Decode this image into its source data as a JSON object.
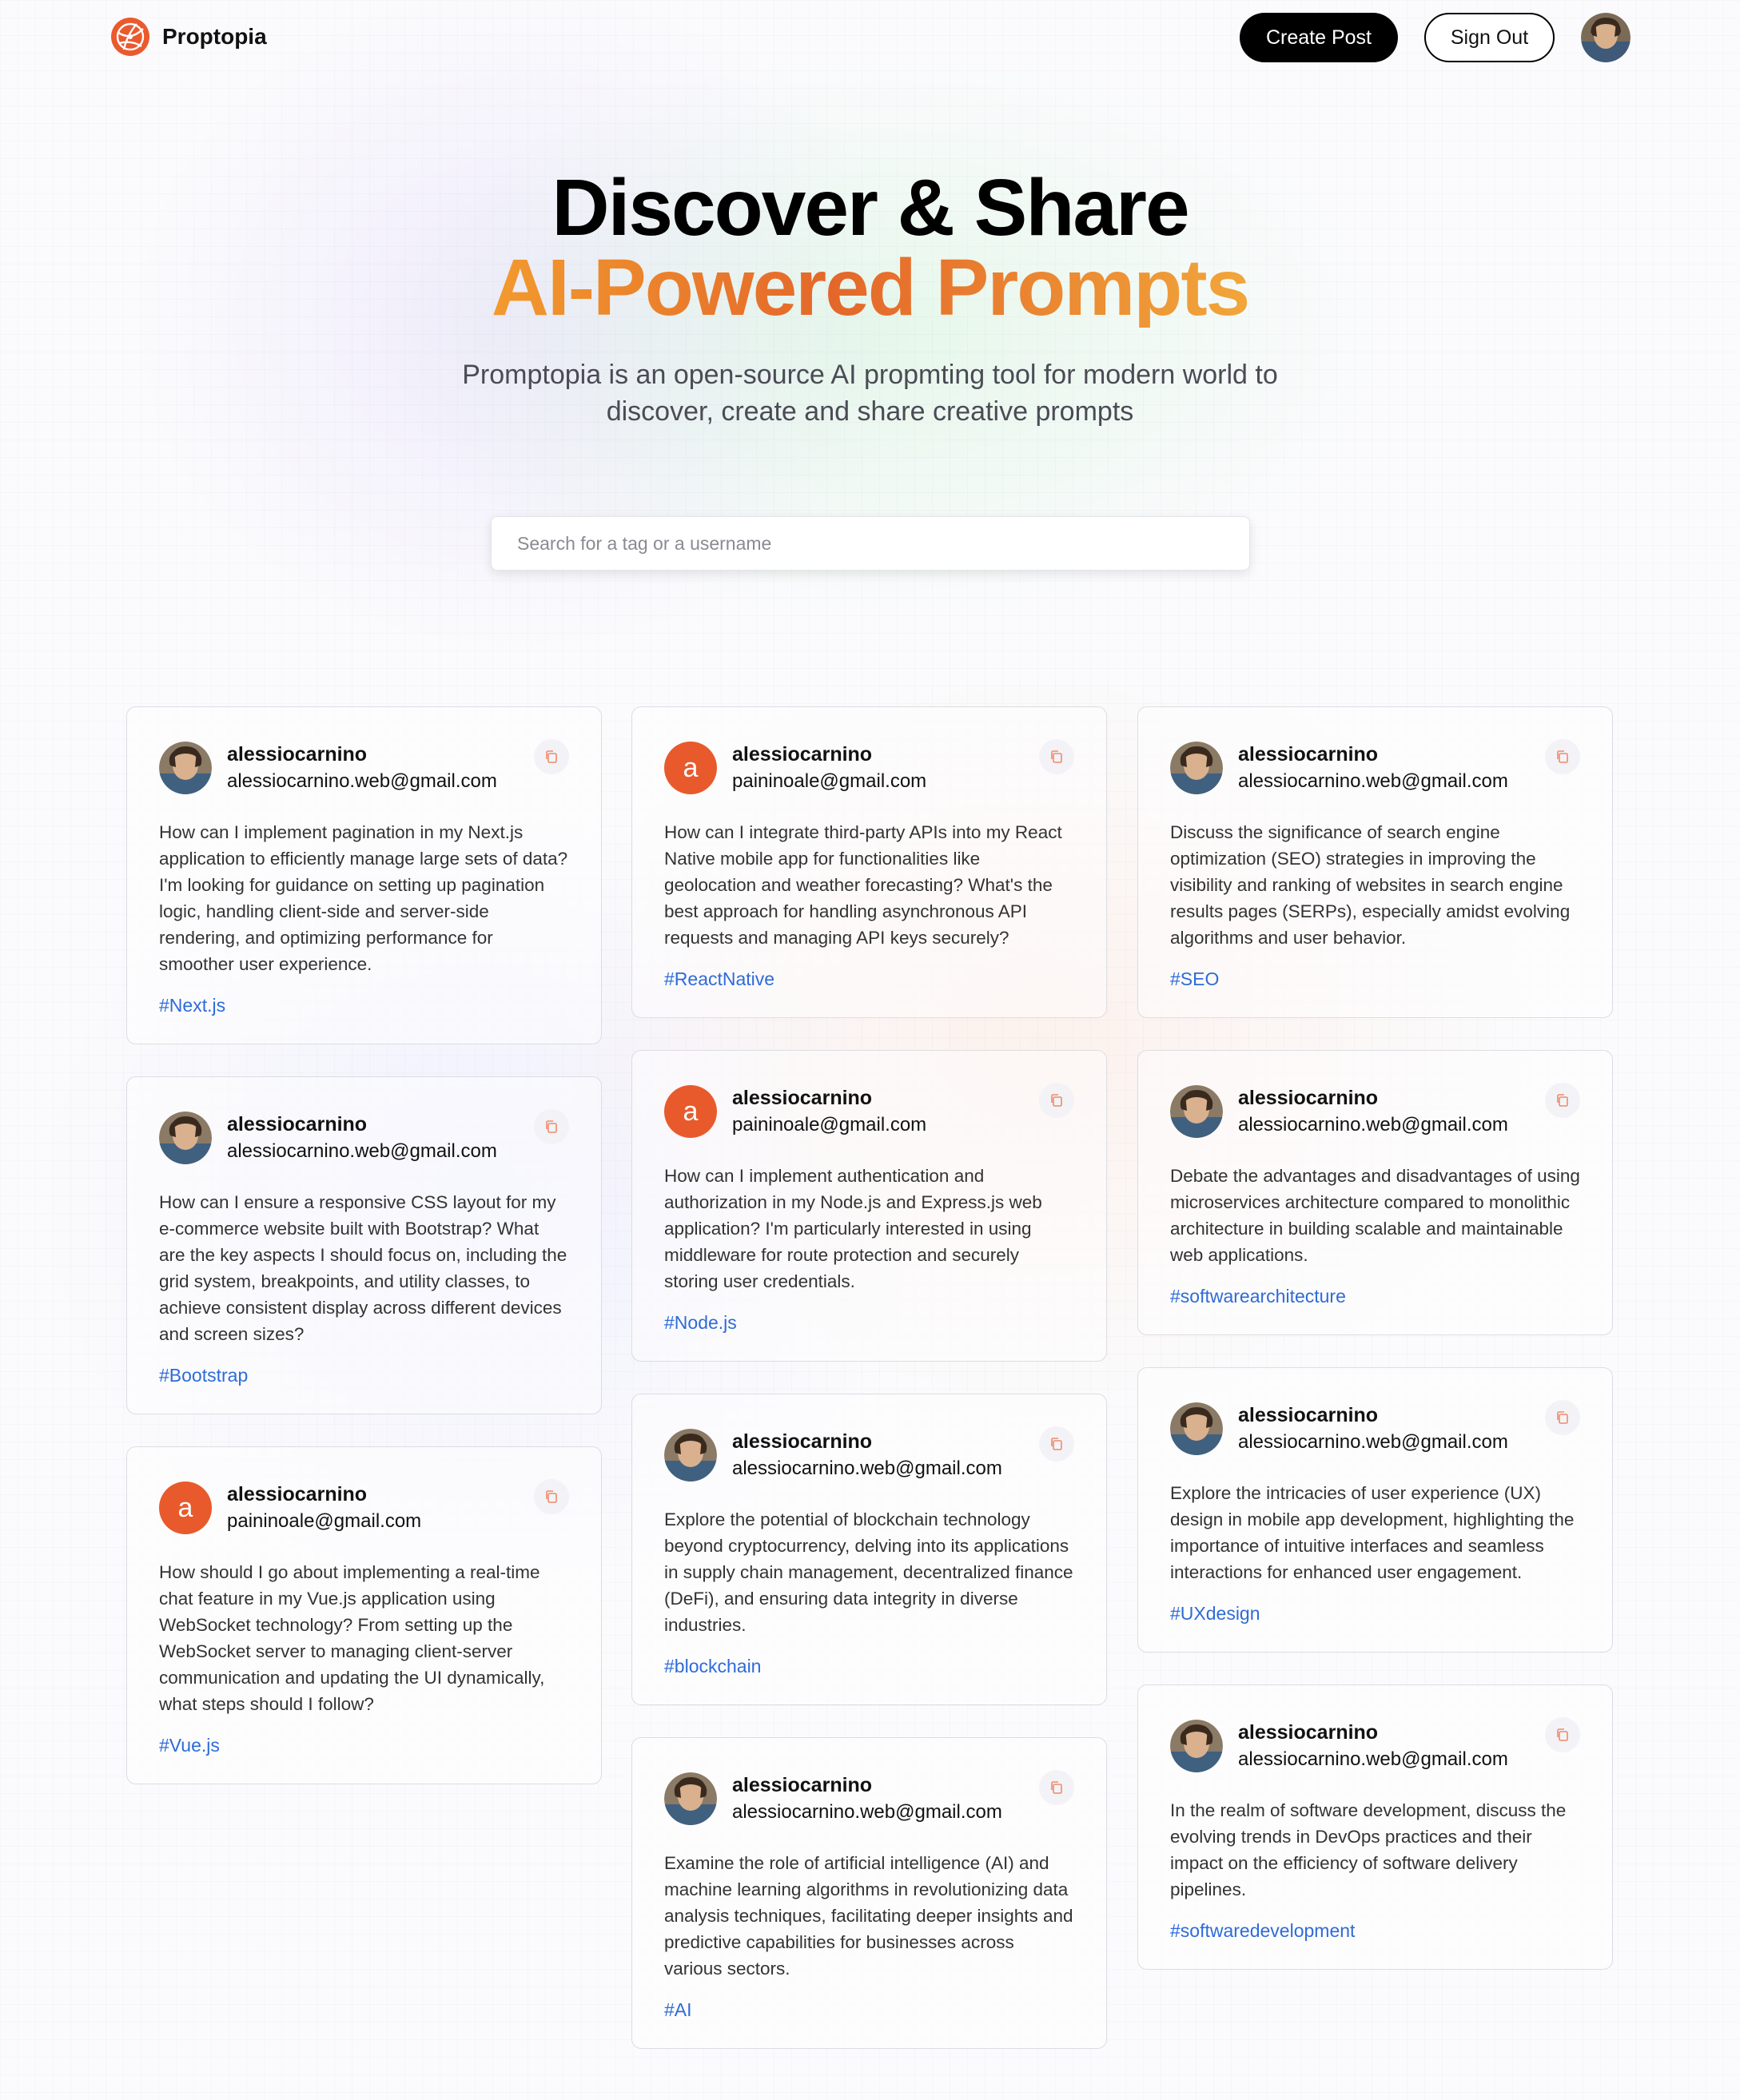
{
  "brand": {
    "name": "Proptopia"
  },
  "nav": {
    "create_label": "Create Post",
    "signout_label": "Sign Out"
  },
  "hero": {
    "title_line1": "Discover & Share",
    "title_line2": "AI-Powered Prompts",
    "description": "Promptopia is an open-source AI propmting tool for modern world to discover, create and share creative prompts"
  },
  "search": {
    "placeholder": "Search for a tag or a username",
    "value": ""
  },
  "colors": {
    "accent_orange": "#e85a2c",
    "tag_blue": "#2e6bd8"
  },
  "columns": [
    [
      {
        "avatar": "photo",
        "username": "alessiocarnino",
        "email": "alessiocarnino.web@gmail.com",
        "prompt": "How can I implement pagination in my Next.js application to efficiently manage large sets of data? I'm looking for guidance on setting up pagination logic, handling client-side and server-side rendering, and optimizing performance for smoother user experience.",
        "tag": "#Next.js"
      },
      {
        "avatar": "photo",
        "username": "alessiocarnino",
        "email": "alessiocarnino.web@gmail.com",
        "prompt": "How can I ensure a responsive CSS layout for my e-commerce website built with Bootstrap? What are the key aspects I should focus on, including the grid system, breakpoints, and utility classes, to achieve consistent display across different devices and screen sizes?",
        "tag": "#Bootstrap"
      },
      {
        "avatar": "letter",
        "letter": "a",
        "username": "alessiocarnino",
        "email": "paininoale@gmail.com",
        "prompt": "How should I go about implementing a real-time chat feature in my Vue.js application using WebSocket technology? From setting up the WebSocket server to managing client-server communication and updating the UI dynamically, what steps should I follow?",
        "tag": "#Vue.js"
      }
    ],
    [
      {
        "avatar": "letter",
        "letter": "a",
        "username": "alessiocarnino",
        "email": "paininoale@gmail.com",
        "prompt": "How can I integrate third-party APIs into my React Native mobile app for functionalities like geolocation and weather forecasting? What's the best approach for handling asynchronous API requests and managing API keys securely?",
        "tag": "#ReactNative"
      },
      {
        "avatar": "letter",
        "letter": "a",
        "username": "alessiocarnino",
        "email": "paininoale@gmail.com",
        "prompt": "How can I implement authentication and authorization in my Node.js and Express.js web application? I'm particularly interested in using middleware for route protection and securely storing user credentials.",
        "tag": "#Node.js"
      },
      {
        "avatar": "photo",
        "username": "alessiocarnino",
        "email": "alessiocarnino.web@gmail.com",
        "prompt": "Explore the potential of blockchain technology beyond cryptocurrency, delving into its applications in supply chain management, decentralized finance (DeFi), and ensuring data integrity in diverse industries.",
        "tag": "#blockchain"
      },
      {
        "avatar": "photo",
        "username": "alessiocarnino",
        "email": "alessiocarnino.web@gmail.com",
        "prompt": "Examine the role of artificial intelligence (AI) and machine learning algorithms in revolutionizing data analysis techniques, facilitating deeper insights and predictive capabilities for businesses across various sectors.",
        "tag": "#AI"
      }
    ],
    [
      {
        "avatar": "photo",
        "username": "alessiocarnino",
        "email": "alessiocarnino.web@gmail.com",
        "prompt": "Discuss the significance of search engine optimization (SEO) strategies in improving the visibility and ranking of websites in search engine results pages (SERPs), especially amidst evolving algorithms and user behavior.",
        "tag": "#SEO"
      },
      {
        "avatar": "photo",
        "username": "alessiocarnino",
        "email": "alessiocarnino.web@gmail.com",
        "prompt": "Debate the advantages and disadvantages of using microservices architecture compared to monolithic architecture in building scalable and maintainable web applications.",
        "tag": "#softwarearchitecture"
      },
      {
        "avatar": "photo",
        "username": "alessiocarnino",
        "email": "alessiocarnino.web@gmail.com",
        "prompt": "Explore the intricacies of user experience (UX) design in mobile app development, highlighting the importance of intuitive interfaces and seamless interactions for enhanced user engagement.",
        "tag": "#UXdesign"
      },
      {
        "avatar": "photo",
        "username": "alessiocarnino",
        "email": "alessiocarnino.web@gmail.com",
        "prompt": "In the realm of software development, discuss the evolving trends in DevOps practices and their impact on the efficiency of software delivery pipelines.",
        "tag": "#softwaredevelopment"
      }
    ]
  ]
}
